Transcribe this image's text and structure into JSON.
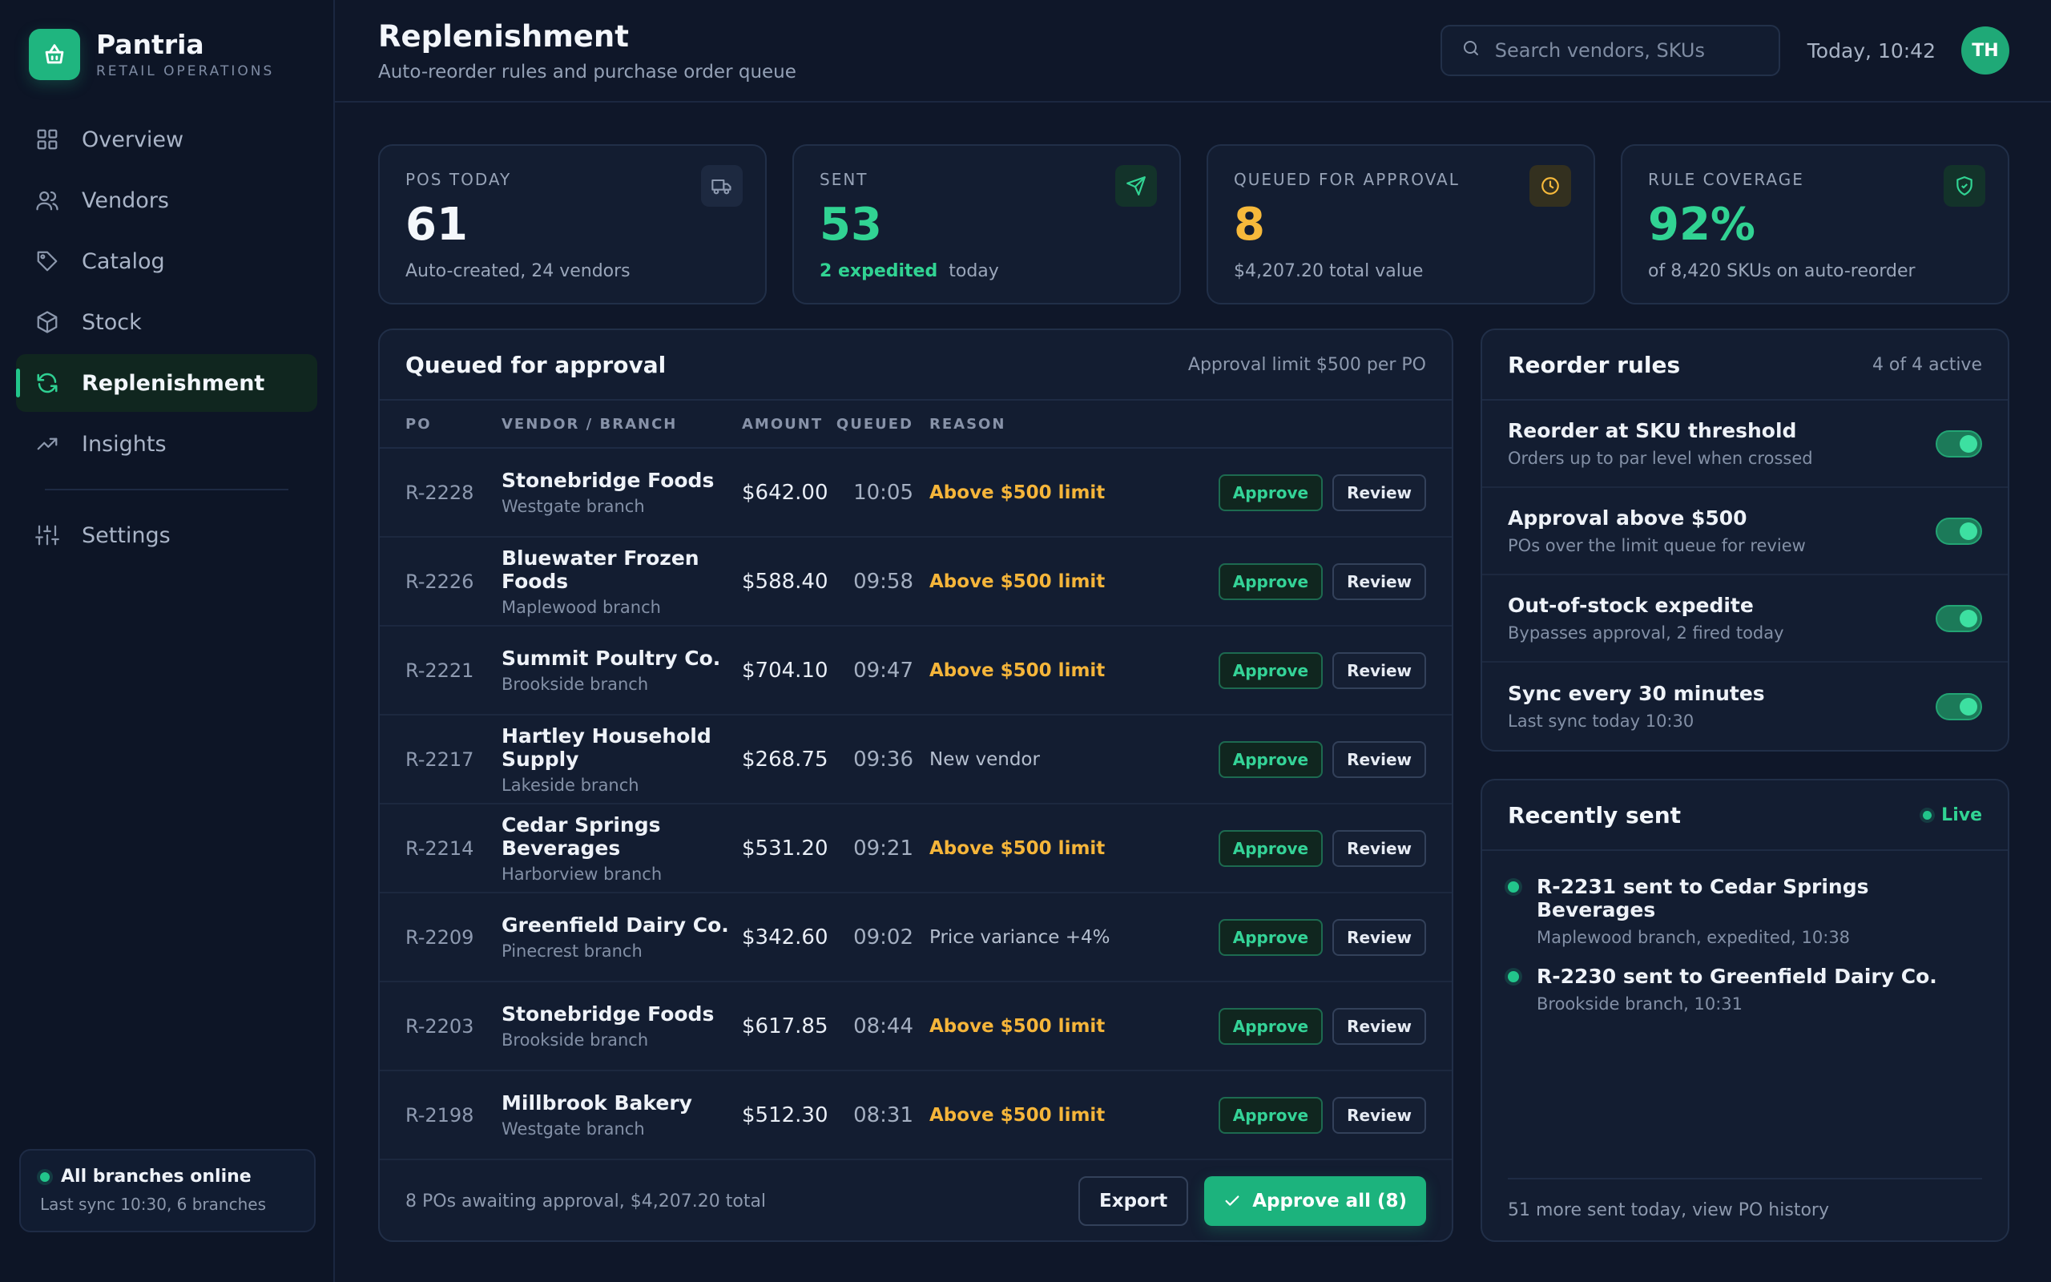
{
  "brand": {
    "name": "Pantria",
    "sub": "RETAIL OPERATIONS"
  },
  "nav": [
    {
      "label": "Overview",
      "icon": "grid-icon"
    },
    {
      "label": "Vendors",
      "icon": "users-icon"
    },
    {
      "label": "Catalog",
      "icon": "tag-icon"
    },
    {
      "label": "Stock",
      "icon": "box-icon"
    },
    {
      "label": "Replenishment",
      "icon": "refresh-icon",
      "active": true
    },
    {
      "label": "Insights",
      "icon": "trend-icon"
    },
    {
      "label": "Settings",
      "icon": "sliders-icon"
    }
  ],
  "status": {
    "title": "All branches online",
    "sub": "Last sync 10:30, 6 branches"
  },
  "header": {
    "title": "Replenishment",
    "subtitle": "Auto-reorder rules and purchase order queue",
    "search_placeholder": "Search vendors, SKUs",
    "date": "Today, 10:42",
    "avatar": "TH"
  },
  "kpis": [
    {
      "label": "POS TODAY",
      "value": "61",
      "sub": "Auto-created, 24 vendors",
      "icon": "truck-icon",
      "color": "#f4f7fb"
    },
    {
      "label": "SENT",
      "value": "53",
      "sub_highlight": "2 expedited",
      "sub": "today",
      "icon": "send-icon",
      "color": "#31d393"
    },
    {
      "label": "QUEUED FOR APPROVAL",
      "value": "8",
      "sub": "$4,207.20 total value",
      "icon": "clock-icon",
      "color": "#f6b93b"
    },
    {
      "label": "RULE COVERAGE",
      "value": "92%",
      "sub": "of 8,420 SKUs on auto-reorder",
      "icon": "shield-icon",
      "color": "#31d393"
    }
  ],
  "queue": {
    "title": "Queued for approval",
    "meta": "Approval limit $500 per PO",
    "columns": [
      "PO",
      "VENDOR / BRANCH",
      "AMOUNT",
      "QUEUED",
      "REASON"
    ],
    "approve_label": "Approve",
    "review_label": "Review",
    "rows": [
      {
        "po": "R-2228",
        "vendor": "Stonebridge Foods",
        "branch": "Westgate branch",
        "amount": "$642.00",
        "queued": "10:05",
        "reason": "Above $500 limit",
        "flag": true
      },
      {
        "po": "R-2226",
        "vendor": "Bluewater Frozen Foods",
        "branch": "Maplewood branch",
        "amount": "$588.40",
        "queued": "09:58",
        "reason": "Above $500 limit",
        "flag": true
      },
      {
        "po": "R-2221",
        "vendor": "Summit Poultry Co.",
        "branch": "Brookside branch",
        "amount": "$704.10",
        "queued": "09:47",
        "reason": "Above $500 limit",
        "flag": true
      },
      {
        "po": "R-2217",
        "vendor": "Hartley Household Supply",
        "branch": "Lakeside branch",
        "amount": "$268.75",
        "queued": "09:36",
        "reason": "New vendor",
        "flag": false
      },
      {
        "po": "R-2214",
        "vendor": "Cedar Springs Beverages",
        "branch": "Harborview branch",
        "amount": "$531.20",
        "queued": "09:21",
        "reason": "Above $500 limit",
        "flag": true
      },
      {
        "po": "R-2209",
        "vendor": "Greenfield Dairy Co.",
        "branch": "Pinecrest branch",
        "amount": "$342.60",
        "queued": "09:02",
        "reason": "Price variance +4%",
        "flag": false
      },
      {
        "po": "R-2203",
        "vendor": "Stonebridge Foods",
        "branch": "Brookside branch",
        "amount": "$617.85",
        "queued": "08:44",
        "reason": "Above $500 limit",
        "flag": true
      },
      {
        "po": "R-2198",
        "vendor": "Millbrook Bakery",
        "branch": "Westgate branch",
        "amount": "$512.30",
        "queued": "08:31",
        "reason": "Above $500 limit",
        "flag": true
      }
    ],
    "footer_text": "8 POs awaiting approval, $4,207.20 total",
    "export_label": "Export",
    "approve_all_label": "Approve all (8)"
  },
  "rules": {
    "title": "Reorder rules",
    "meta": "4 of 4 active",
    "items": [
      {
        "name": "Reorder at SKU threshold",
        "sub": "Orders up to par level when crossed",
        "on": true
      },
      {
        "name": "Approval above $500",
        "sub": "POs over the limit queue for review",
        "on": true
      },
      {
        "name": "Out-of-stock expedite",
        "sub": "Bypasses approval, 2 fired today",
        "on": true
      },
      {
        "name": "Sync every 30 minutes",
        "sub": "Last sync today 10:30",
        "on": true
      }
    ]
  },
  "recent": {
    "title": "Recently sent",
    "live": "Live",
    "items": [
      {
        "title": "R-2231 sent to Cedar Springs Beverages",
        "sub": "Maplewood branch, expedited, 10:38"
      },
      {
        "title": "R-2230 sent to Greenfield Dairy Co.",
        "sub": "Brookside branch, 10:31"
      }
    ],
    "footer": "51 more sent today, view PO history"
  }
}
